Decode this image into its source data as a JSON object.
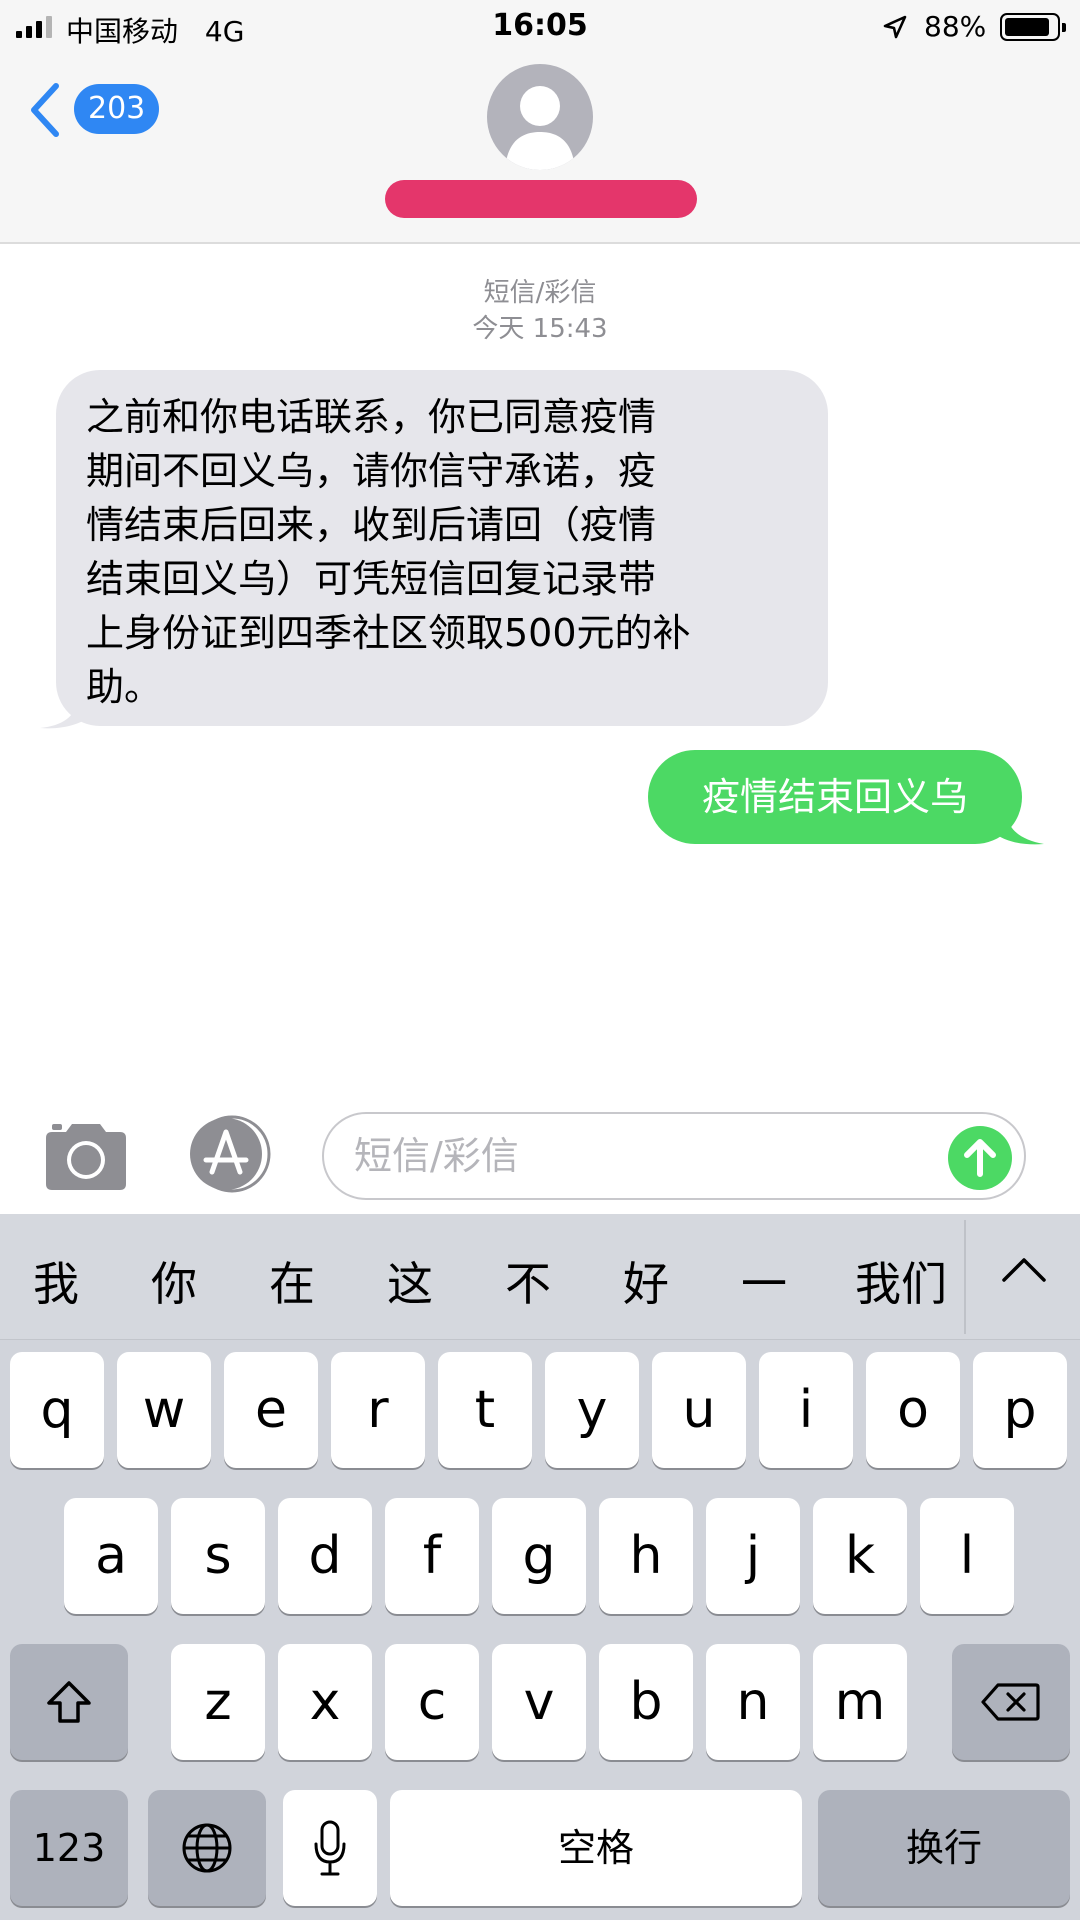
{
  "status_bar": {
    "carrier": "中国移动",
    "network": "4G",
    "time": "16:05",
    "battery_percent": "88%",
    "battery_level": 0.88,
    "icons": [
      "signal-icon",
      "location-arrow-icon",
      "battery-icon"
    ]
  },
  "header": {
    "back_badge": "203",
    "icons": [
      "chevron-left-icon",
      "person-avatar-icon"
    ],
    "name_redacted": true,
    "redaction_color": "#e4366b"
  },
  "thread": {
    "service_label": "短信/彩信",
    "timestamp": "今天 15:43",
    "messages": [
      {
        "direction": "incoming",
        "lines": [
          "之前和你电话联系，你已同意疫情",
          "期间不回义乌，请你信守承诺，疫",
          "情结束后回来，收到后请回（疫情",
          "结束回义乌）可凭短信回复记录带",
          "上身份证到四季社区领取500元的补",
          "助。"
        ]
      },
      {
        "direction": "outgoing",
        "text": "疫情结束回义乌"
      }
    ]
  },
  "input_bar": {
    "placeholder": "短信/彩信",
    "value": "",
    "icons": [
      "camera-icon",
      "app-store-icon",
      "send-arrow-icon"
    ],
    "send_color": "#4cd964"
  },
  "keyboard": {
    "candidates": [
      "我",
      "你",
      "在",
      "这",
      "不",
      "好",
      "一",
      "我们"
    ],
    "rows": [
      [
        "q",
        "w",
        "e",
        "r",
        "t",
        "y",
        "u",
        "i",
        "o",
        "p"
      ],
      [
        "a",
        "s",
        "d",
        "f",
        "g",
        "h",
        "j",
        "k",
        "l"
      ],
      [
        "z",
        "x",
        "c",
        "v",
        "b",
        "n",
        "m"
      ]
    ],
    "numbers_key": "123",
    "space_key": "空格",
    "return_key": "换行",
    "icons": [
      "chevron-up-icon",
      "shift-icon",
      "delete-icon",
      "globe-icon",
      "microphone-icon"
    ]
  },
  "colors": {
    "incoming_bubble": "#e6e6eb",
    "outgoing_bubble": "#4cd964",
    "link_blue": "#2f87f3",
    "keyboard_background": "#d1d4db"
  }
}
